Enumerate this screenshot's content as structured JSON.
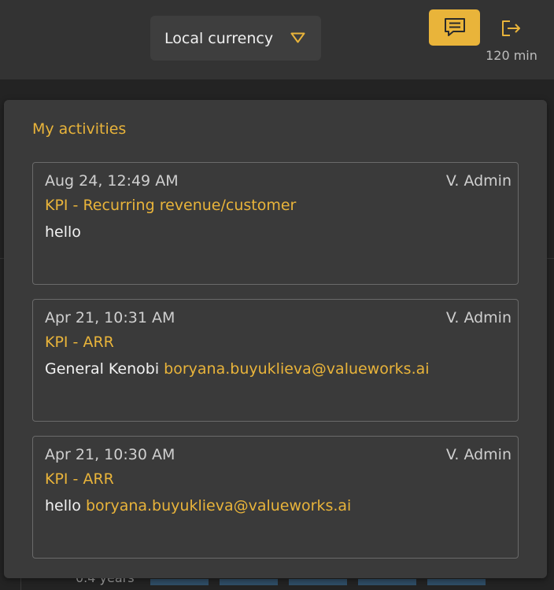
{
  "header": {
    "currency_select": {
      "label": "Local currency",
      "icon": "chevron-down-icon"
    },
    "chat_button": {
      "icon": "chat-icon"
    },
    "logout_button": {
      "icon": "logout-icon"
    },
    "session_timer": "120 min"
  },
  "background": {
    "partial_text": "0.4 years"
  },
  "activities": {
    "title": "My activities",
    "items": [
      {
        "date": "Aug 24, 12:49 AM",
        "author": "V. Admin",
        "kpi": "KPI - Recurring revenue/customer",
        "message": "hello",
        "mention": ""
      },
      {
        "date": "Apr 21, 10:31 AM",
        "author": "V. Admin",
        "kpi": "KPI - ARR",
        "message": "General Kenobi ",
        "mention": "boryana.buyuklieva@valueworks.ai"
      },
      {
        "date": "Apr 21, 10:30 AM",
        "author": "V. Admin",
        "kpi": "KPI - ARR",
        "message": "hello ",
        "mention": "boryana.buyuklieva@valueworks.ai"
      }
    ]
  },
  "colors": {
    "accent": "#e9b43a",
    "topbar": "#333333",
    "popover": "#3a3a3a",
    "page_bg": "#232323"
  }
}
